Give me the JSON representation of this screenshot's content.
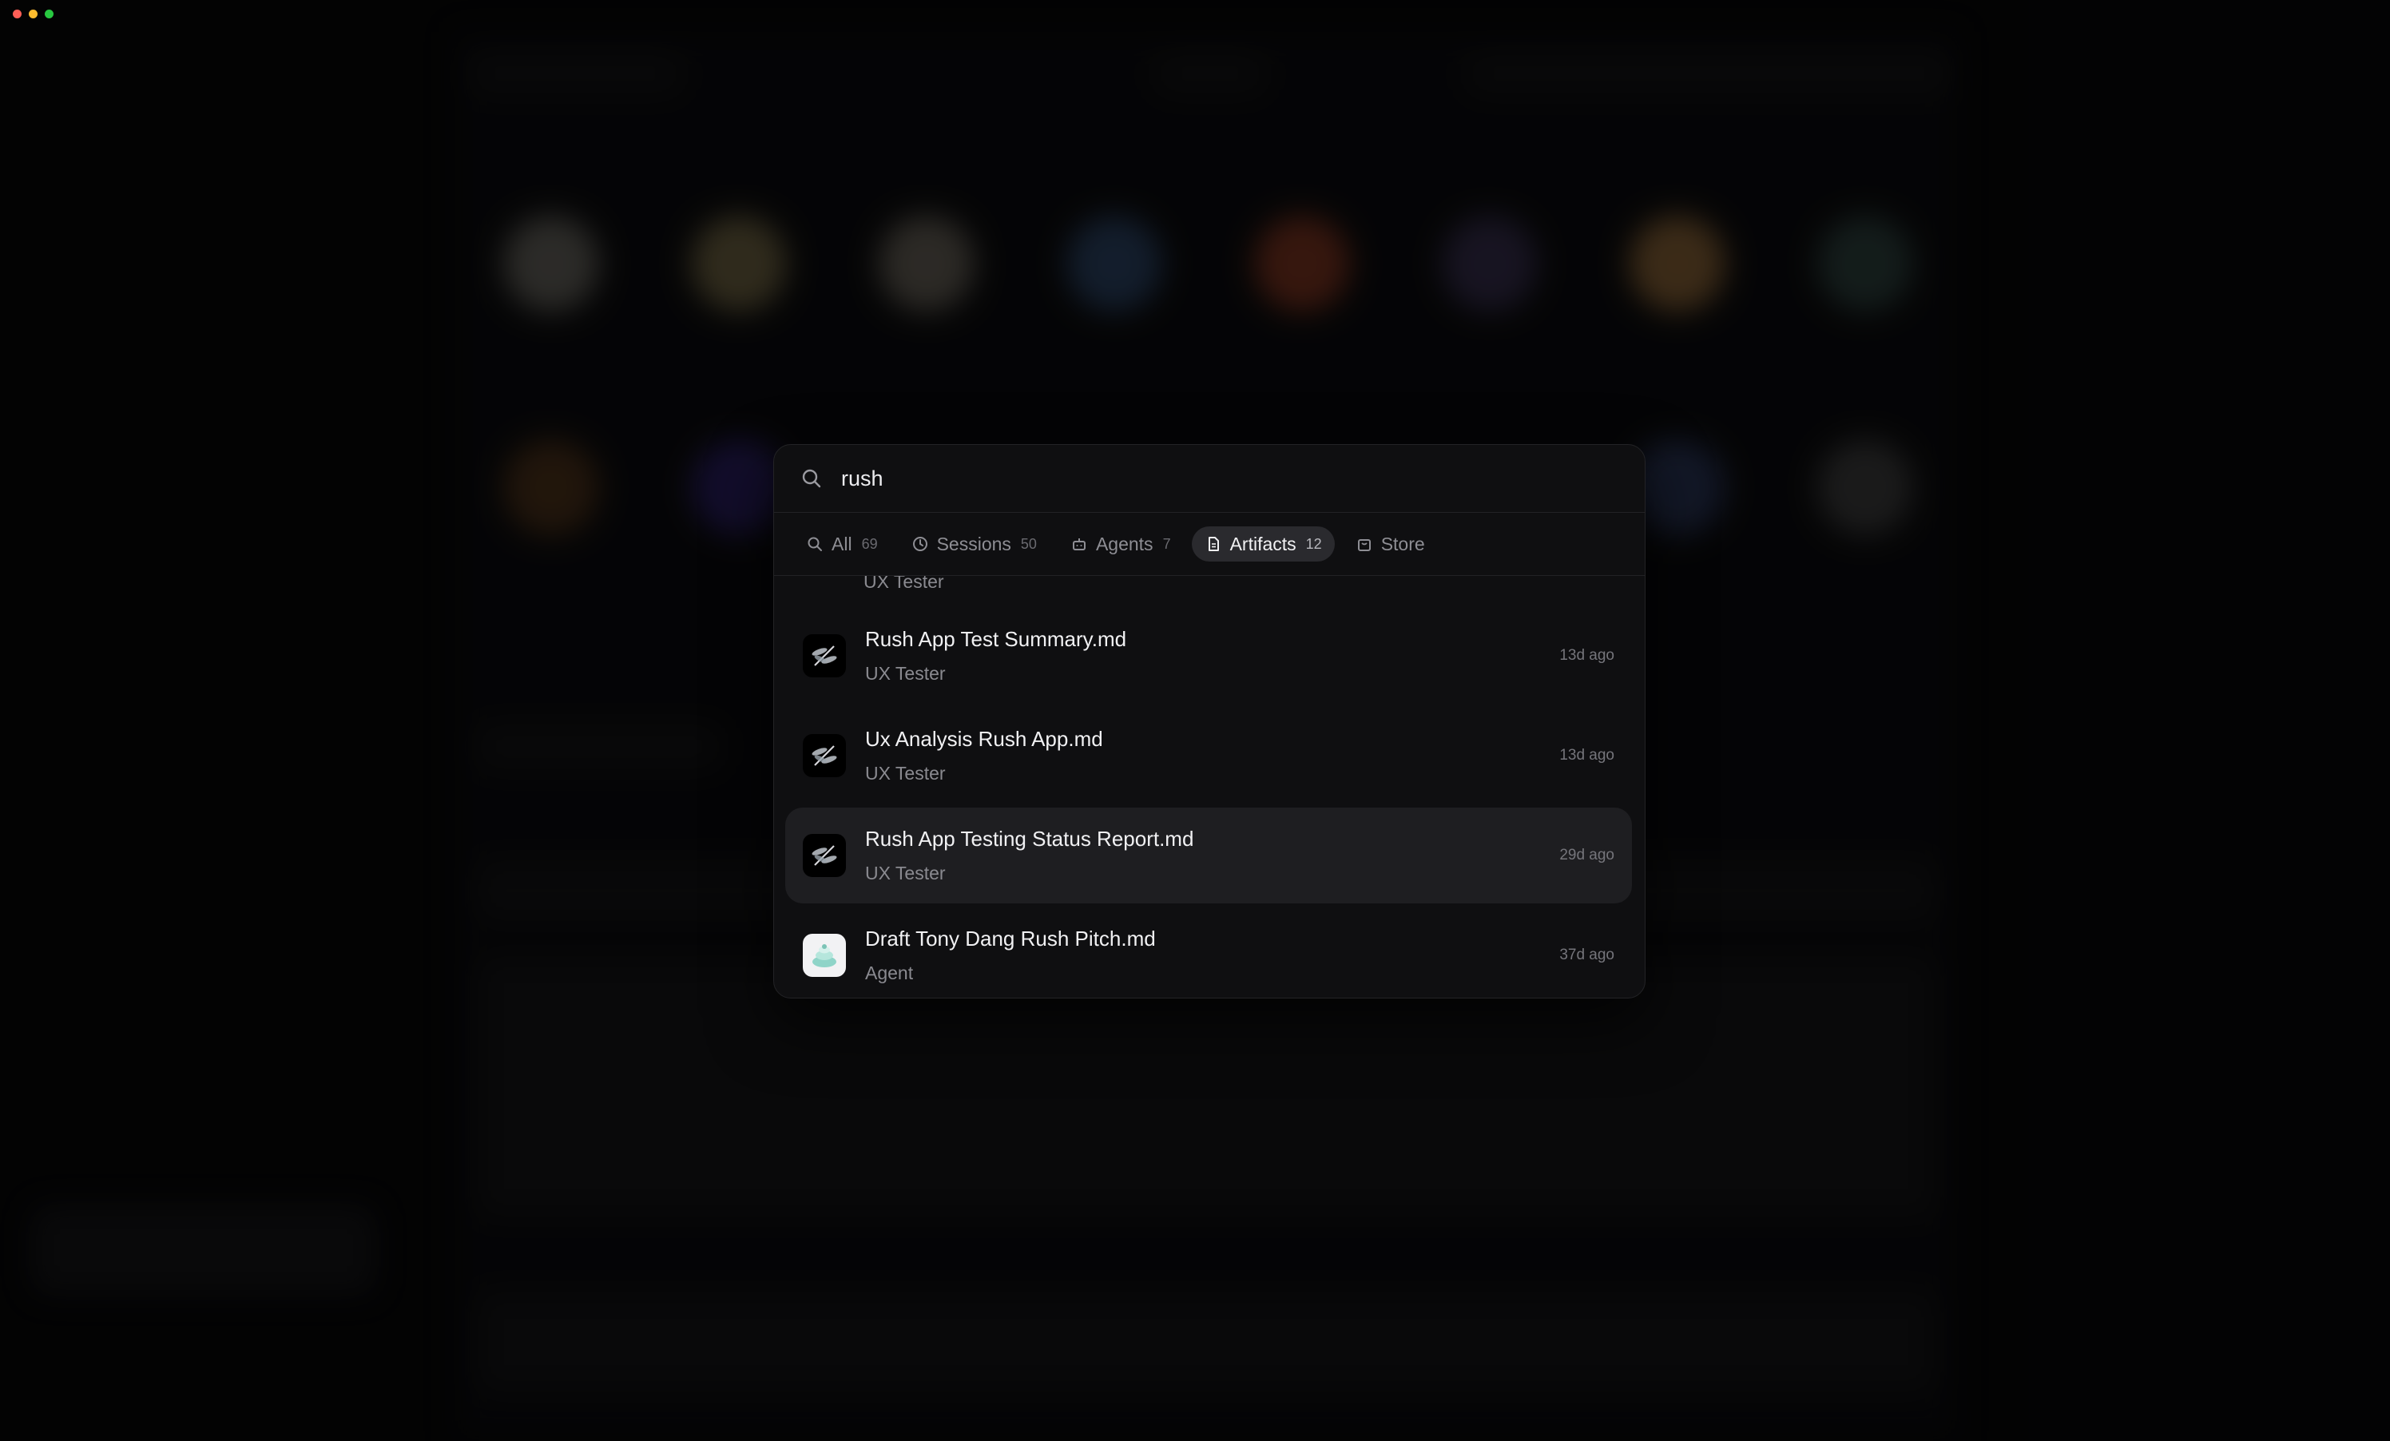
{
  "search": {
    "value": "rush",
    "placeholder": "Search"
  },
  "tabs": [
    {
      "label": "All",
      "count": "69",
      "icon": "search-icon"
    },
    {
      "label": "Sessions",
      "count": "50",
      "icon": "clock-icon"
    },
    {
      "label": "Agents",
      "count": "7",
      "icon": "robot-icon"
    },
    {
      "label": "Artifacts",
      "count": "12",
      "icon": "document-icon",
      "active": true
    },
    {
      "label": "Store",
      "count": "",
      "icon": "bag-icon"
    }
  ],
  "results": {
    "partial_subtitle": "UX Tester",
    "items": [
      {
        "title": "Rush App Test Summary.md",
        "subtitle": "UX Tester",
        "time": "13d ago",
        "icon": "dragonfly-icon"
      },
      {
        "title": "Ux Analysis Rush App.md",
        "subtitle": "UX Tester",
        "time": "13d ago",
        "icon": "dragonfly-icon"
      },
      {
        "title": "Rush App Testing Status Report.md",
        "subtitle": "UX Tester",
        "time": "29d ago",
        "icon": "dragonfly-icon",
        "selected": true
      },
      {
        "title": "Draft Tony Dang Rush Pitch.md",
        "subtitle": "Agent",
        "time": "37d ago",
        "icon": "agent-avatar-icon"
      }
    ]
  },
  "colors": {
    "background": "#060607",
    "palette": "#0f0f11",
    "active_tab": "#2a2a2e",
    "selected_row": "#1e1e21"
  }
}
